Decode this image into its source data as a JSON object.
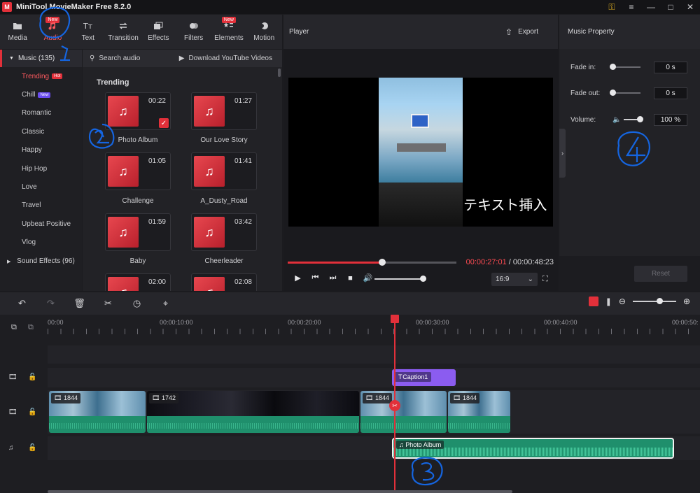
{
  "app": {
    "title": "MiniTool MovieMaker Free 8.2.0"
  },
  "toolbar": {
    "items": [
      {
        "label": "Media"
      },
      {
        "label": "Audio",
        "badge": "New"
      },
      {
        "label": "Text"
      },
      {
        "label": "Transition"
      },
      {
        "label": "Effects"
      },
      {
        "label": "Filters"
      },
      {
        "label": "Elements",
        "badge": "New"
      },
      {
        "label": "Motion"
      }
    ]
  },
  "categories": {
    "header": "Music (135)",
    "items": [
      {
        "label": "Trending",
        "badge": "Hot"
      },
      {
        "label": "Chill",
        "badge": "New"
      },
      {
        "label": "Romantic"
      },
      {
        "label": "Classic"
      },
      {
        "label": "Happy"
      },
      {
        "label": "Hip Hop"
      },
      {
        "label": "Love"
      },
      {
        "label": "Travel"
      },
      {
        "label": "Upbeat Positive"
      },
      {
        "label": "Vlog"
      }
    ],
    "footer": "Sound Effects (96)"
  },
  "library": {
    "search": "Search audio",
    "download": "Download YouTube Videos",
    "section": "Trending",
    "tracks": [
      {
        "name": "Photo Album",
        "duration": "00:22"
      },
      {
        "name": "Our Love Story",
        "duration": "01:27"
      },
      {
        "name": "Challenge",
        "duration": "01:05"
      },
      {
        "name": "A_Dusty_Road",
        "duration": "01:41"
      },
      {
        "name": "Baby",
        "duration": "01:59"
      },
      {
        "name": "Cheerleader",
        "duration": "03:42"
      },
      {
        "name": "",
        "duration": "02:00"
      },
      {
        "name": "",
        "duration": "02:08"
      }
    ]
  },
  "player": {
    "title": "Player",
    "export": "Export",
    "caption": "テキスト挿入",
    "current_time": "00:00:27:01",
    "separator": " / ",
    "total_time": "00:00:48:23",
    "aspect": "16:9",
    "progress": 0.56,
    "volume": 1.0
  },
  "music_property": {
    "title": "Music Property",
    "fade_in": {
      "label": "Fade in:",
      "value": "0 s"
    },
    "fade_out": {
      "label": "Fade out:",
      "value": "0 s"
    },
    "volume": {
      "label": "Volume:",
      "value": "100 %"
    },
    "reset": "Reset"
  },
  "timeline": {
    "ticks": [
      "00:00",
      "00:00:10:00",
      "00:00:20:00",
      "00:00:30:00",
      "00:00:40:00",
      "00:00:50:"
    ],
    "caption_clip": "Caption1",
    "video_clips": [
      "1844",
      "1742",
      "1844",
      "1844"
    ],
    "music_clip": "Photo Album"
  },
  "colors": {
    "accent": "#e2303a",
    "audio_wave": "#1f8f6c",
    "caption": "#8b5cf0",
    "annotation": "#1565e0"
  }
}
